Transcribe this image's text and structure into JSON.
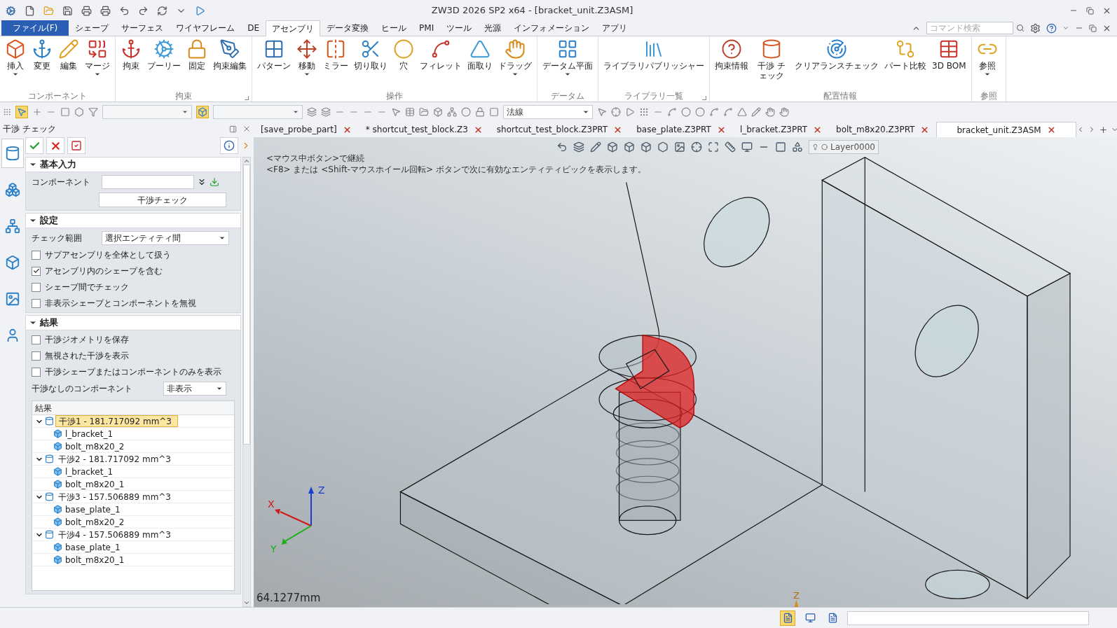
{
  "window": {
    "title": "ZW3D 2026 SP2 x64  - [bracket_unit.Z3ASM]"
  },
  "menu_tabs": [
    {
      "label": "ファイル(F)",
      "kind": "file",
      "selected": false
    },
    {
      "label": "シェープ",
      "kind": "tab",
      "selected": false
    },
    {
      "label": "サーフェス",
      "kind": "tab",
      "selected": false
    },
    {
      "label": "ワイヤフレーム",
      "kind": "tab",
      "selected": false
    },
    {
      "label": "DE",
      "kind": "tab",
      "selected": false
    },
    {
      "label": "アセンブリ",
      "kind": "tab",
      "selected": true
    },
    {
      "label": "データ変換",
      "kind": "tab",
      "selected": false
    },
    {
      "label": "ヒール",
      "kind": "tab",
      "selected": false
    },
    {
      "label": "PMI",
      "kind": "tab",
      "selected": false
    },
    {
      "label": "ツール",
      "kind": "tab",
      "selected": false
    },
    {
      "label": "光源",
      "kind": "tab",
      "selected": false
    },
    {
      "label": "インフォメーション",
      "kind": "tab",
      "selected": false
    },
    {
      "label": "アプリ",
      "kind": "tab",
      "selected": false
    }
  ],
  "search": {
    "placeholder": "コマンド検索"
  },
  "ribbon_groups": [
    {
      "label": "コンポーネント",
      "launcher": false,
      "buttons": [
        {
          "label": "挿入",
          "dropdown": true
        },
        {
          "label": "変更",
          "dropdown": false
        },
        {
          "label": "編集",
          "dropdown": false
        },
        {
          "label": "マージ",
          "dropdown": true
        }
      ]
    },
    {
      "label": "拘束",
      "launcher": true,
      "buttons": [
        {
          "label": "拘束",
          "dropdown": false
        },
        {
          "label": "プーリー",
          "dropdown": false
        },
        {
          "label": "固定",
          "dropdown": false
        },
        {
          "label": "拘束編集",
          "dropdown": false
        }
      ]
    },
    {
      "label": "操作",
      "launcher": false,
      "buttons": [
        {
          "label": "パターン",
          "dropdown": false
        },
        {
          "label": "移動",
          "dropdown": true
        },
        {
          "label": "ミラー",
          "dropdown": false
        },
        {
          "label": "切り取り",
          "dropdown": false
        },
        {
          "label": "穴",
          "dropdown": false
        },
        {
          "label": "フィレット",
          "dropdown": false
        },
        {
          "label": "面取り",
          "dropdown": false
        },
        {
          "label": "ドラッグ",
          "dropdown": true
        }
      ]
    },
    {
      "label": "データム",
      "launcher": false,
      "buttons": [
        {
          "label": "データム平面",
          "dropdown": true
        }
      ]
    },
    {
      "label": "ライブラリ一覧",
      "launcher": true,
      "buttons": [
        {
          "label": "ライブラリパブリッシャー",
          "dropdown": false
        }
      ]
    },
    {
      "label": "配置情報",
      "launcher": false,
      "buttons": [
        {
          "label": "拘束情報",
          "dropdown": false
        },
        {
          "label": "干渉 チェック",
          "dropdown": false
        },
        {
          "label": "クリアランスチェック",
          "dropdown": false
        },
        {
          "label": "パート比較",
          "dropdown": false
        },
        {
          "label": "3D BOM",
          "dropdown": false
        }
      ]
    },
    {
      "label": "参照",
      "launcher": false,
      "buttons": [
        {
          "label": "参照",
          "dropdown": true
        }
      ]
    }
  ],
  "toolbar": {
    "filter_value": "法線"
  },
  "panel": {
    "title": "干渉 チェック",
    "side_tabs": [
      {
        "selected": true
      },
      {
        "selected": false
      },
      {
        "selected": false
      },
      {
        "selected": false
      },
      {
        "selected": false
      },
      {
        "selected": false
      }
    ],
    "basic": {
      "title": "基本入力",
      "expanded": true,
      "field_label": "コンポーネント",
      "button": "干渉チェック"
    },
    "settings": {
      "title": "設定",
      "expanded": true,
      "range_label": "チェック範囲",
      "range_value": "選択エンティティ間",
      "options": [
        {
          "label": "サブアセンブリを全体として扱う",
          "checked": false
        },
        {
          "label": "アセンブリ内のシェープを含む",
          "checked": true
        },
        {
          "label": "シェープ間でチェック",
          "checked": false
        },
        {
          "label": "非表示シェープとコンポーネントを無視",
          "checked": false
        }
      ]
    },
    "results": {
      "title": "結果",
      "expanded": true,
      "options": [
        {
          "label": "干渉ジオメトリを保存",
          "checked": false
        },
        {
          "label": "無視された干渉を表示",
          "checked": false
        },
        {
          "label": "干渉シェープまたはコンポーネントのみを表示",
          "checked": false
        }
      ],
      "no_interference_label": "干渉なしのコンポーネント",
      "no_interference_value": "非表示",
      "list_header": "結果",
      "items": [
        {
          "label": "干渉1 - 181.717092 mm^3",
          "selected": true,
          "expanded": true,
          "children": [
            {
              "label": "l_bracket_1",
              "selected": false
            },
            {
              "label": "bolt_m8x20_2",
              "selected": false
            }
          ]
        },
        {
          "label": "干渉2 - 181.717092 mm^3",
          "selected": false,
          "expanded": true,
          "children": [
            {
              "label": "l_bracket_1",
              "selected": false
            },
            {
              "label": "bolt_m8x20_1",
              "selected": false
            }
          ]
        },
        {
          "label": "干渉3 - 157.506889 mm^3",
          "selected": false,
          "expanded": true,
          "children": [
            {
              "label": "base_plate_1",
              "selected": false
            },
            {
              "label": "bolt_m8x20_2",
              "selected": false
            }
          ]
        },
        {
          "label": "干渉4 - 157.506889 mm^3",
          "selected": false,
          "expanded": true,
          "children": [
            {
              "label": "base_plate_1",
              "selected": false
            },
            {
              "label": "bolt_m8x20_1",
              "selected": false
            }
          ]
        }
      ]
    }
  },
  "doc_tabs": [
    {
      "label": "[save_probe_part]",
      "selected": false
    },
    {
      "label": "* shortcut_test_block.Z3",
      "selected": false
    },
    {
      "label": "shortcut_test_block.Z3PRT",
      "selected": false
    },
    {
      "label": "base_plate.Z3PRT",
      "selected": false
    },
    {
      "label": "l_bracket.Z3PRT",
      "selected": false
    },
    {
      "label": "bolt_m8x20.Z3PRT",
      "selected": false
    },
    {
      "label": "bracket_unit.Z3ASM",
      "selected": true
    }
  ],
  "viewport": {
    "hints": [
      "<マウス中ボタン>で継続",
      "<F8> または <Shift-マウスホイール回転> ボタンで次に有効なエンティティピックを表示します。"
    ],
    "layer": "Layer0000",
    "axes": {
      "x": "X",
      "y": "Y",
      "z": "Z"
    },
    "bottom_axis": "Z",
    "measurement": "64.1277mm"
  },
  "status_bar": {
    "tools": [
      {
        "selected": true
      },
      {
        "selected": false
      },
      {
        "selected": false
      }
    ]
  }
}
